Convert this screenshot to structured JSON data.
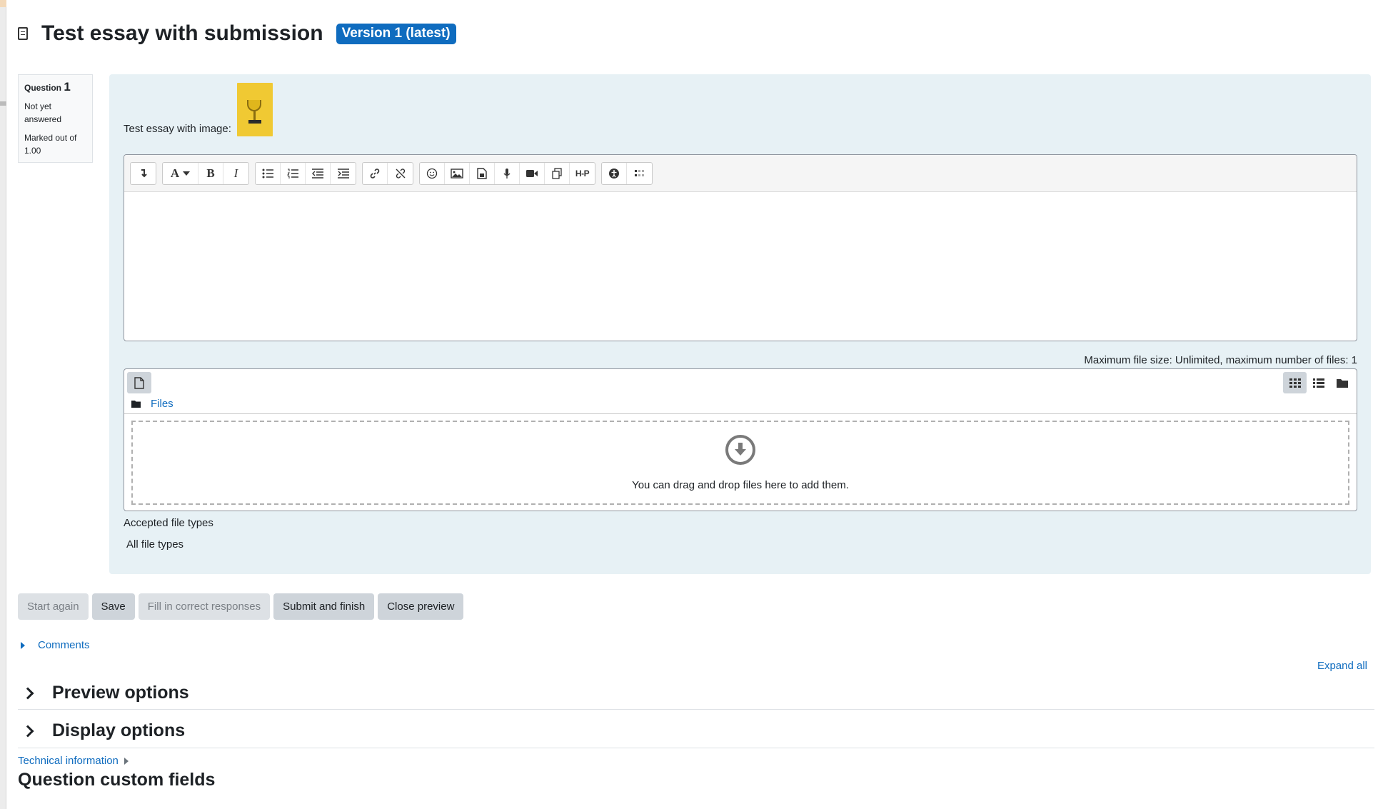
{
  "header": {
    "title": "Test essay with submission",
    "version_badge": "Version 1 (latest)"
  },
  "question_info": {
    "label": "Question",
    "number": "1",
    "state": "Not yet answered",
    "grade": "Marked out of 1.00"
  },
  "question": {
    "text": "Test essay with image:"
  },
  "editor": {
    "toolbar_buttons": [
      "collapse",
      "font-style",
      "bold",
      "italic",
      "bullet-list",
      "numbered-list",
      "outdent",
      "indent",
      "link",
      "unlink",
      "emoji",
      "image",
      "media",
      "record-audio",
      "record-video",
      "manage-files",
      "h5p",
      "accessibility",
      "equation"
    ],
    "bold_glyph": "B",
    "italic_glyph": "I",
    "font_glyph": "A",
    "h5p_label": "H-P"
  },
  "filemanager": {
    "max_size_text": "Maximum file size: Unlimited, maximum number of files: 1",
    "path_label": "Files",
    "drop_text": "You can drag and drop files here to add them.",
    "accepted_label": "Accepted file types",
    "accepted_value": "All file types"
  },
  "actions": {
    "start_again": "Start again",
    "save": "Save",
    "fill_correct": "Fill in correct responses",
    "submit_finish": "Submit and finish",
    "close_preview": "Close preview"
  },
  "comments_link": "Comments",
  "expand_all": "Expand all",
  "sections": {
    "preview_options": "Preview options",
    "display_options": "Display options"
  },
  "technical_info": "Technical information",
  "custom_fields_heading": "Question custom fields",
  "colors": {
    "accent": "#0f6cbf",
    "question_bg": "#e7f1f5",
    "button_bg": "#ced4da"
  }
}
